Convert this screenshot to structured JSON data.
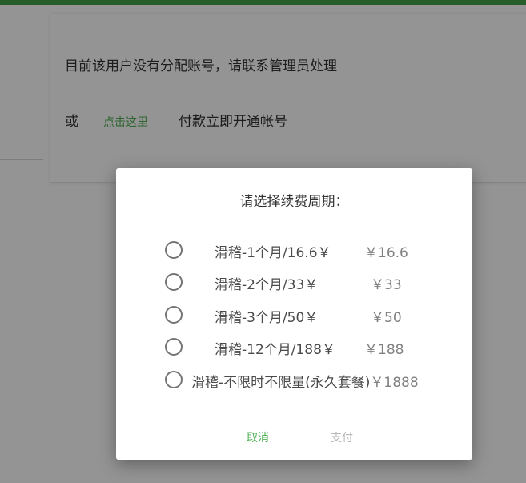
{
  "page": {
    "notice": "目前该用户没有分配账号，请联系管理员处理",
    "or_label": "或",
    "click_here": "点击这里",
    "pay_label": "付款立即开通帐号"
  },
  "dialog": {
    "title": "请选择续费周期：",
    "plans": [
      {
        "name": "滑稽-1个月/16.6￥",
        "price": "￥16.6"
      },
      {
        "name": "滑稽-2个月/33￥",
        "price": "￥33"
      },
      {
        "name": "滑稽-3个月/50￥",
        "price": "￥50"
      },
      {
        "name": "滑稽-12个月/188￥",
        "price": "￥188"
      },
      {
        "name": "滑稽-不限时不限量(永久套餐)",
        "price": "￥1888"
      }
    ],
    "cancel_label": "取消",
    "pay_label": "支付"
  },
  "colors": {
    "accent": "#4caf50",
    "top_bar": "#43a047",
    "disabled": "#b8b8b8"
  }
}
